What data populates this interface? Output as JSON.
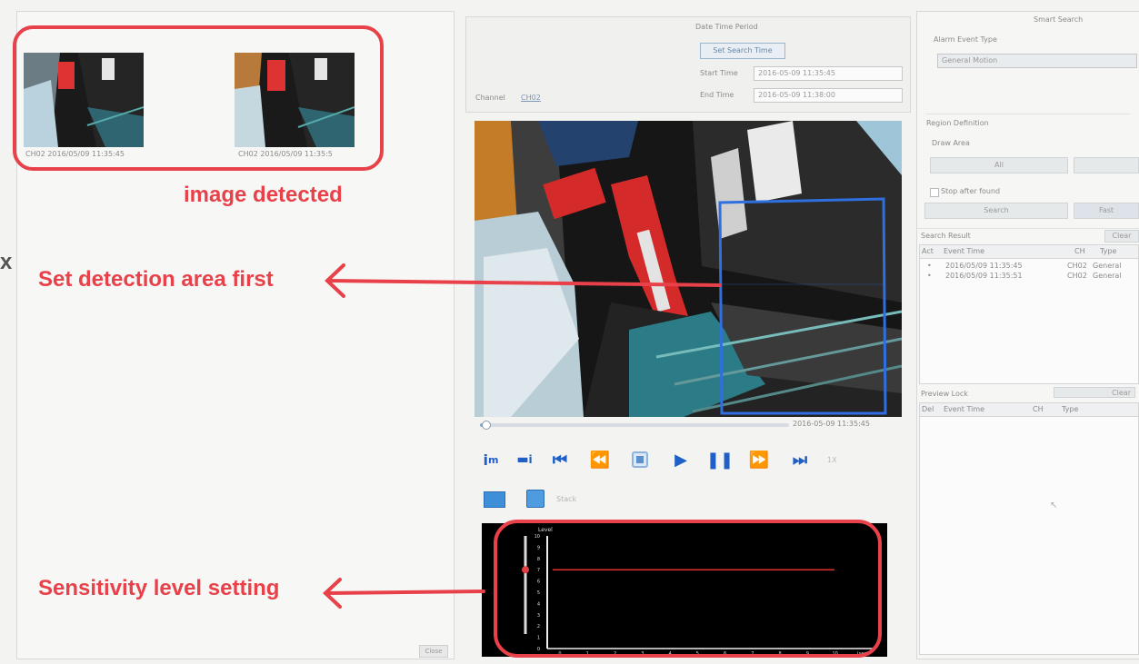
{
  "annotations": {
    "image_detected": "image detected",
    "set_detection": "Set detection area first",
    "sensitivity": "Sensitivity level setting",
    "left_edge_mark": "x"
  },
  "thumbnails": [
    {
      "caption": "CH02 2016/05/09 11:35:45"
    },
    {
      "caption": "CH02 2016/05/09 11:35:5"
    }
  ],
  "left_panel": {
    "close_label": "Close"
  },
  "center_top": {
    "date_time_period": "Date Time Period",
    "set_search_time": "Set Search Time",
    "start_time_label": "Start Time",
    "start_time_value": "2016-05-09 11:35:45",
    "end_time_label": "End Time",
    "end_time_value": "2016-05-09 11:38:00",
    "channel_label": "Channel",
    "channel_value": "CH02"
  },
  "playback": {
    "timestamp": "2016-05-09 11:35:45",
    "progress": 0.02,
    "speed_label": "1X"
  },
  "extra": {
    "stack_label": "Stack"
  },
  "graph": {
    "title": "Level",
    "y_ticks": [
      "10",
      "9",
      "8",
      "7",
      "6",
      "5",
      "4",
      "3",
      "2",
      "1",
      "0"
    ],
    "x_ticks": [
      "0",
      "1",
      "2",
      "3",
      "4",
      "5",
      "6",
      "7",
      "8",
      "9",
      "10",
      "(sec)"
    ],
    "level": 7
  },
  "right_panel": {
    "title": "Smart Search",
    "alarm_event_type_label": "Alarm Event Type",
    "alarm_event_type_value": "General Motion",
    "region_definition": "Region Definition",
    "draw_area": "Draw Area",
    "all_btn": "All",
    "clear_area_btn": "",
    "stop_after_found": "Stop after found",
    "search_btn": "Search",
    "fast_btn": "Fast",
    "search_result_label": "Search Result",
    "clear_result_btn": "Clear",
    "result_headers": [
      "Act",
      "Event Time",
      "CH",
      "Type"
    ],
    "results": [
      {
        "time": "2016/05/09 11:35:45",
        "ch": "CH02",
        "type": "General"
      },
      {
        "time": "2016/05/09 11:35:51",
        "ch": "CH02",
        "type": "General"
      }
    ],
    "preview_label": "Preview Lock",
    "preview_clear": "Clear",
    "preview_headers": [
      "Del",
      "Event Time",
      "CH",
      "Type"
    ]
  }
}
